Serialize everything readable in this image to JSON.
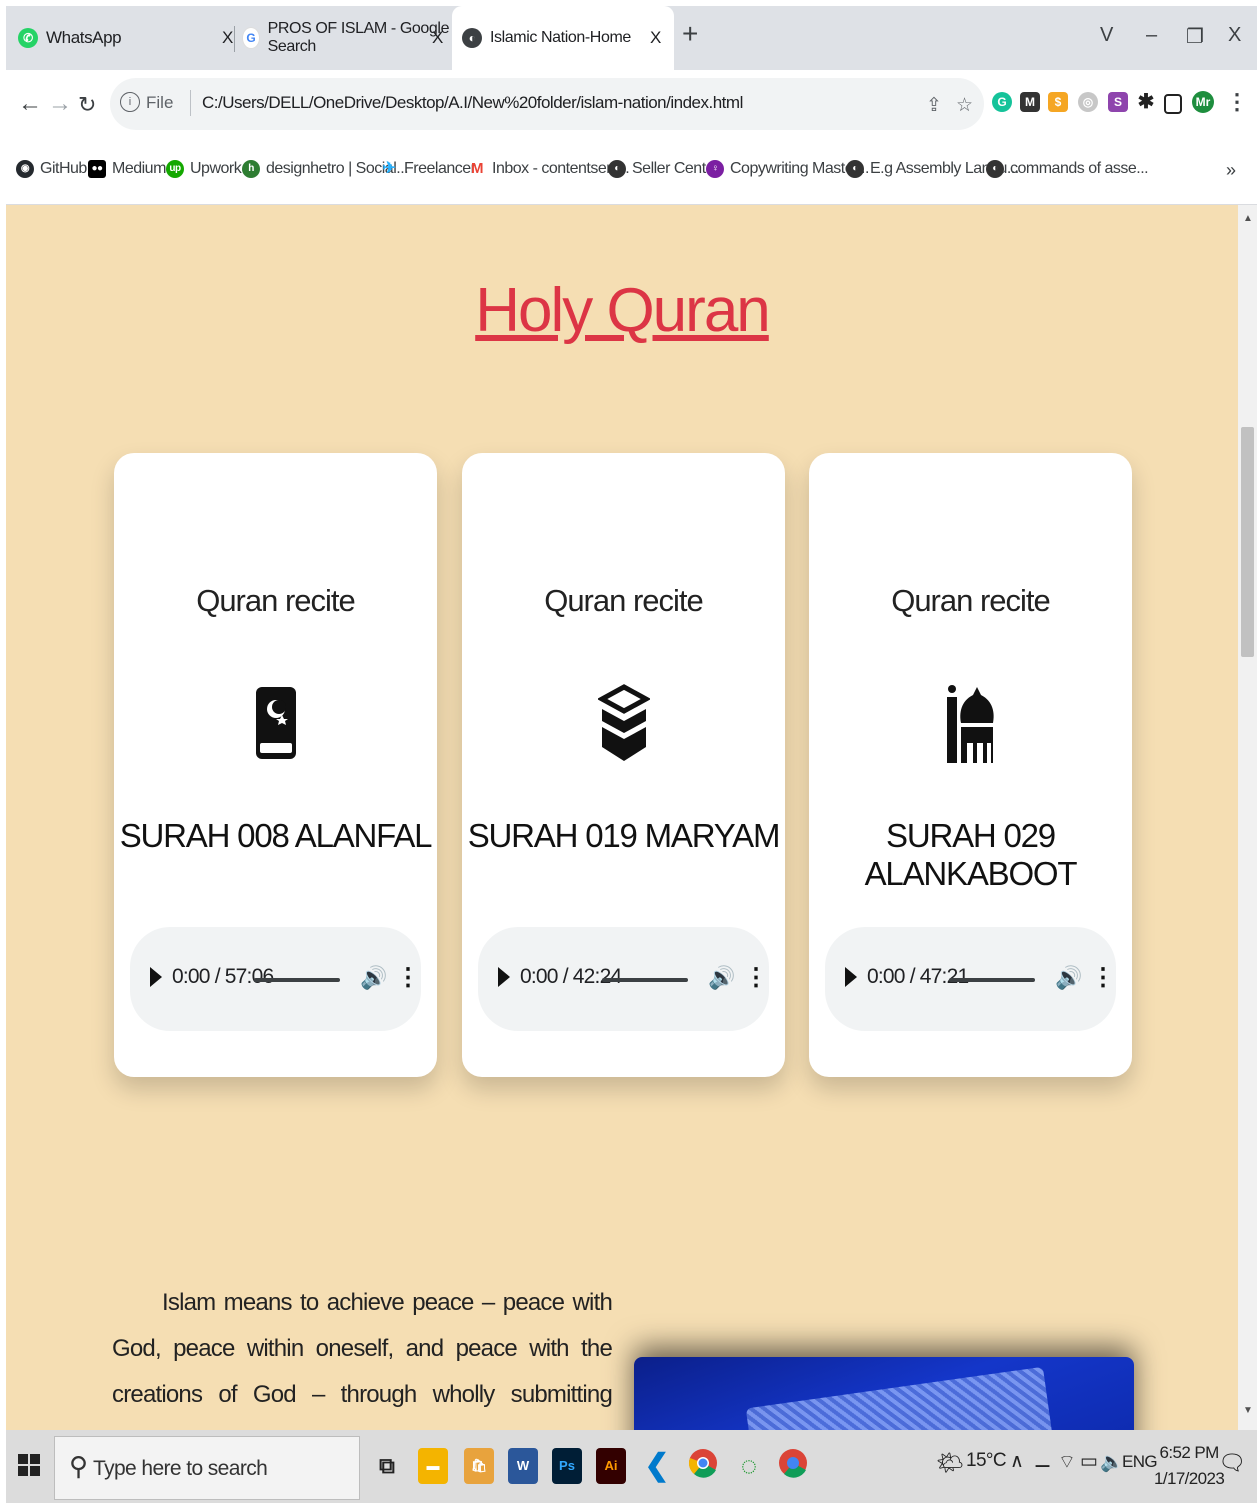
{
  "browser": {
    "tabs": [
      {
        "title": "WhatsApp",
        "close": "X",
        "icon": "whatsapp-icon",
        "active": false
      },
      {
        "title": "PROS OF ISLAM - Google Search",
        "close": "X",
        "icon": "google-icon",
        "active": false
      },
      {
        "title": "Islamic Nation-Home",
        "close": "X",
        "icon": "globe-icon",
        "active": true
      }
    ],
    "new_tab": "+",
    "window_controls": {
      "dropdown": "V",
      "minimize": "–",
      "restore": "❐",
      "close": "X"
    },
    "address": {
      "scheme_label": "File",
      "url": "C:/Users/DELL/OneDrive/Desktop/A.I/New%20folder/islam-nation/index.html"
    },
    "profile_initials": "Mr",
    "bookmarks": [
      {
        "label": "GitHub",
        "color": "#24292e"
      },
      {
        "label": "Medium",
        "color": "#000000"
      },
      {
        "label": "Upwork",
        "color": "#14a800"
      },
      {
        "label": "designhetro | Social...",
        "color": "#2e7d32"
      },
      {
        "label": "Freelancer",
        "color": "#29b2fe"
      },
      {
        "label": "Inbox - contentserv...",
        "color": "#ea4335"
      },
      {
        "label": "Seller Center",
        "color": "#333333"
      },
      {
        "label": "Copywriting Master...",
        "color": "#7b1fa2"
      },
      {
        "label": "E.g Assembly Langu...",
        "color": "#333333"
      },
      {
        "label": "commands of asse...",
        "color": "#333333"
      }
    ],
    "bookmarks_overflow": "»"
  },
  "page": {
    "title": "Holy Quran",
    "accent": "#dc3545",
    "background": "#f5deb3",
    "cards": [
      {
        "label": "Quran recite",
        "icon": "quran-book-icon",
        "surah": "SURAH 008 ALANFAL",
        "time": "0:00 / 57:06"
      },
      {
        "label": "Quran recite",
        "icon": "kaaba-icon",
        "surah": "SURAH 019 MARYAM",
        "time": "0:00 / 42:24"
      },
      {
        "label": "Quran recite",
        "icon": "mosque-icon",
        "surah": "SURAH 029 ALANKABOOT",
        "time": "0:00 / 47:21"
      }
    ],
    "article_text": "Islam means to achieve peace – peace with God, peace within oneself, and peace with the creations of God – through wholly submitting oneself to God and accepting His guidance. The term Islam derives from the"
  },
  "taskbar": {
    "search_placeholder": "Type here to search",
    "weather": "15°C",
    "language": "ENG",
    "time": "6:52 PM",
    "date": "1/17/2023"
  }
}
